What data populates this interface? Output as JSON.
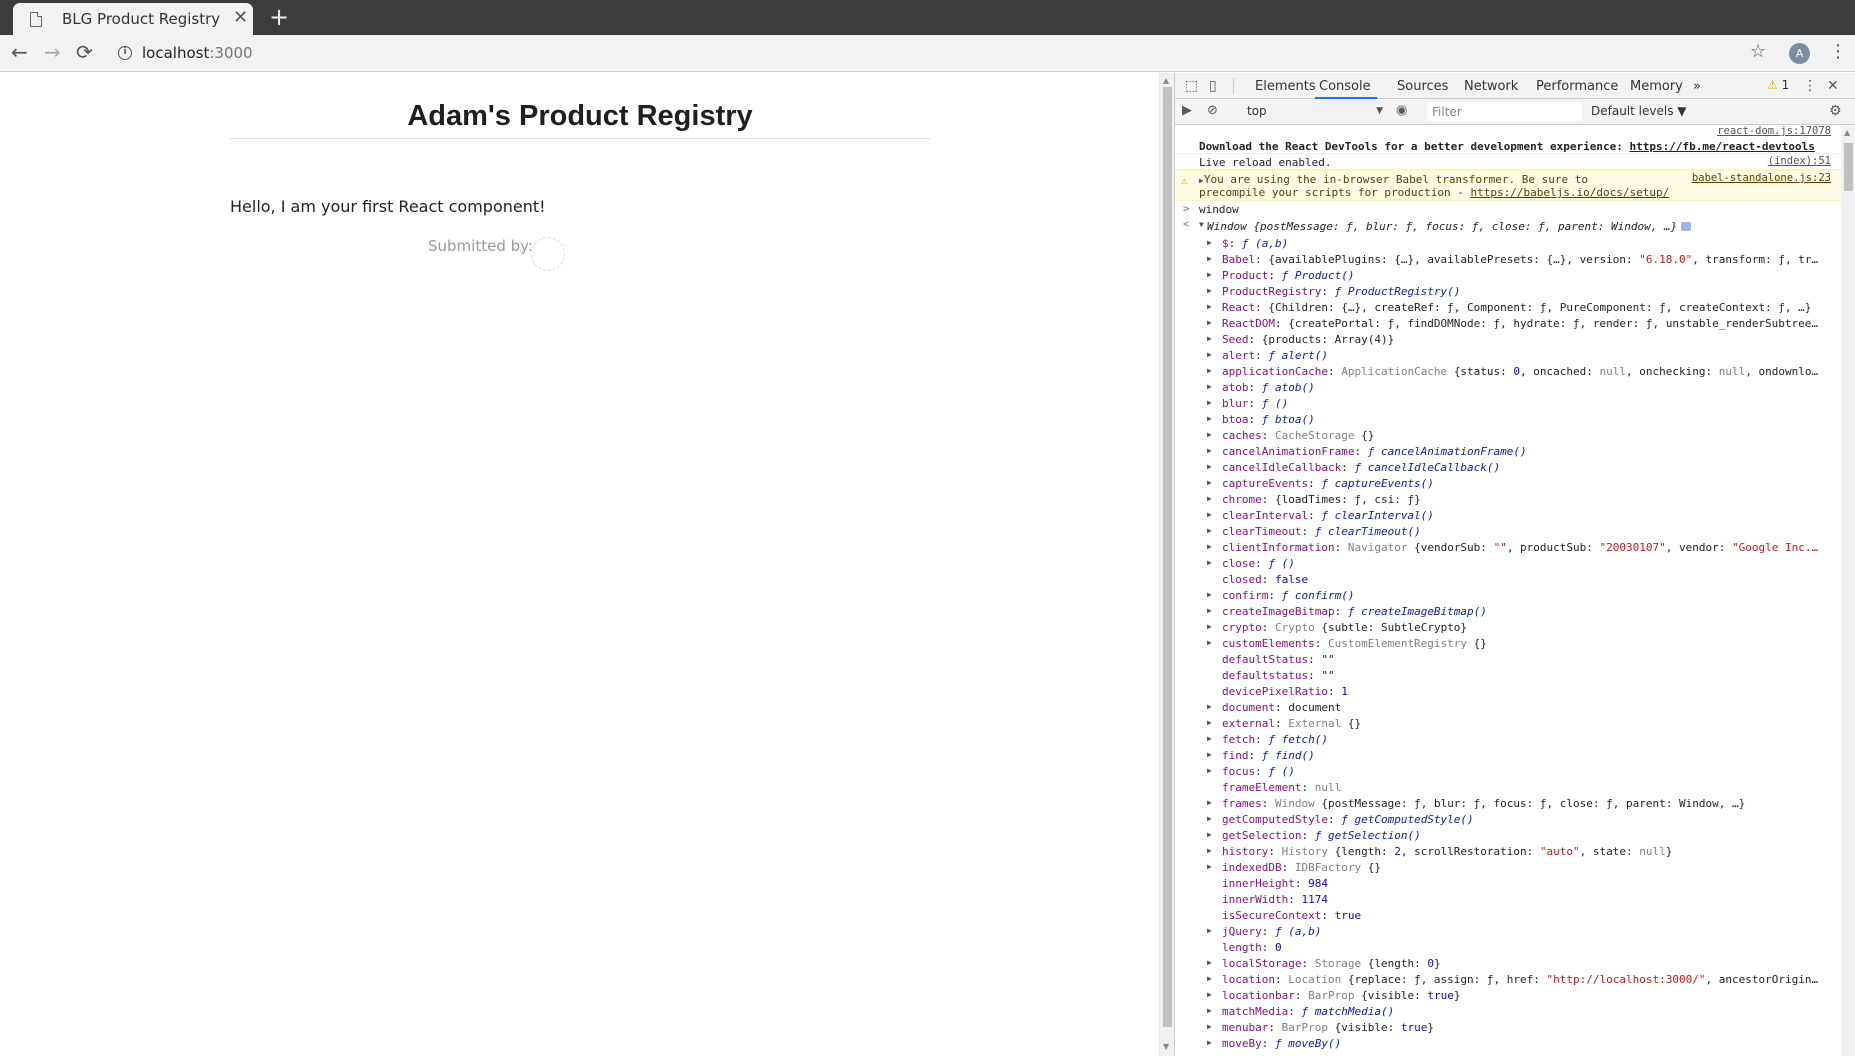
{
  "browser": {
    "tab_title": "BLG Product Registry",
    "tab_close": "✕",
    "new_tab": "+",
    "url_host": "localhost",
    "url_port": ":3000",
    "avatar_letter": "A"
  },
  "page": {
    "title": "Adam's Product Registry",
    "hello": "Hello, I am your first React component!",
    "submitted_by": "Submitted by:"
  },
  "devtools": {
    "tabs": [
      "Elements",
      "Console",
      "Sources",
      "Network",
      "Performance",
      "Memory"
    ],
    "active_tab": "Console",
    "more_tabs": "»",
    "warning_count": "1",
    "context": "top",
    "filter_placeholder": "Filter",
    "levels": "Default levels ▼",
    "messages": {
      "react_src": "react-dom.js:17078",
      "react_msg": "Download the React DevTools for a better development experience: ",
      "react_link": "https://fb.me/react-devtools",
      "live_src": "(index):51",
      "live_msg": "Live reload enabled.",
      "babel_src": "babel-standalone.js:23",
      "babel_line1": "You are using the in-browser Babel transformer. Be sure to",
      "babel_line2": "precompile your scripts for production - ",
      "babel_link": "https://babeljs.io/docs/setup/",
      "input": "window",
      "result": "Window {postMessage: ƒ, blur: ƒ, focus: ƒ, close: ƒ, parent: Window, …}"
    },
    "properties": [
      {
        "exp": true,
        "key": "$",
        "parts": [
          [
            "f",
            "ƒ (a,b)"
          ]
        ]
      },
      {
        "exp": true,
        "key": "Babel",
        "parts": [
          [
            "t",
            "{availablePlugins: {…}, availablePresets: {…}, version: "
          ],
          [
            "s",
            "\"6.18.0\""
          ],
          [
            "t",
            ", transform: ƒ, tr…"
          ]
        ]
      },
      {
        "exp": true,
        "key": "Product",
        "parts": [
          [
            "f",
            "ƒ Product()"
          ]
        ]
      },
      {
        "exp": true,
        "key": "ProductRegistry",
        "parts": [
          [
            "f",
            "ƒ ProductRegistry()"
          ]
        ]
      },
      {
        "exp": true,
        "key": "React",
        "parts": [
          [
            "t",
            "{Children: {…}, createRef: ƒ, Component: ƒ, PureComponent: ƒ, createContext: ƒ, …}"
          ]
        ]
      },
      {
        "exp": true,
        "key": "ReactDOM",
        "parts": [
          [
            "t",
            "{createPortal: ƒ, findDOMNode: ƒ, hydrate: ƒ, render: ƒ, unstable_renderSubtree…"
          ]
        ]
      },
      {
        "exp": true,
        "key": "Seed",
        "parts": [
          [
            "t",
            "{products: Array(4)}"
          ]
        ]
      },
      {
        "exp": true,
        "key": "alert",
        "parts": [
          [
            "f",
            "ƒ alert()"
          ]
        ]
      },
      {
        "exp": true,
        "key": "applicationCache",
        "parts": [
          [
            "c",
            "ApplicationCache "
          ],
          [
            "t",
            "{status: "
          ],
          [
            "n",
            "0"
          ],
          [
            "t",
            ", oncached: "
          ],
          [
            "c",
            "null"
          ],
          [
            "t",
            ", onchecking: "
          ],
          [
            "c",
            "null"
          ],
          [
            "t",
            ", ondownlo…"
          ]
        ]
      },
      {
        "exp": true,
        "key": "atob",
        "parts": [
          [
            "f",
            "ƒ atob()"
          ]
        ]
      },
      {
        "exp": true,
        "key": "blur",
        "parts": [
          [
            "f",
            "ƒ ()"
          ]
        ]
      },
      {
        "exp": true,
        "key": "btoa",
        "parts": [
          [
            "f",
            "ƒ btoa()"
          ]
        ]
      },
      {
        "exp": true,
        "key": "caches",
        "parts": [
          [
            "c",
            "CacheStorage "
          ],
          [
            "t",
            "{}"
          ]
        ]
      },
      {
        "exp": true,
        "key": "cancelAnimationFrame",
        "parts": [
          [
            "f",
            "ƒ cancelAnimationFrame()"
          ]
        ]
      },
      {
        "exp": true,
        "key": "cancelIdleCallback",
        "parts": [
          [
            "f",
            "ƒ cancelIdleCallback()"
          ]
        ]
      },
      {
        "exp": true,
        "key": "captureEvents",
        "parts": [
          [
            "f",
            "ƒ captureEvents()"
          ]
        ]
      },
      {
        "exp": true,
        "key": "chrome",
        "parts": [
          [
            "t",
            "{loadTimes: ƒ, csi: ƒ}"
          ]
        ]
      },
      {
        "exp": true,
        "key": "clearInterval",
        "parts": [
          [
            "f",
            "ƒ clearInterval()"
          ]
        ]
      },
      {
        "exp": true,
        "key": "clearTimeout",
        "parts": [
          [
            "f",
            "ƒ clearTimeout()"
          ]
        ]
      },
      {
        "exp": true,
        "key": "clientInformation",
        "parts": [
          [
            "c",
            "Navigator "
          ],
          [
            "t",
            "{vendorSub: "
          ],
          [
            "s",
            "\"\""
          ],
          [
            "t",
            ", productSub: "
          ],
          [
            "s",
            "\"20030107\""
          ],
          [
            "t",
            ", vendor: "
          ],
          [
            "s",
            "\"Google Inc.…"
          ]
        ]
      },
      {
        "exp": true,
        "key": "close",
        "parts": [
          [
            "f",
            "ƒ ()"
          ]
        ]
      },
      {
        "exp": false,
        "key": "closed",
        "parts": [
          [
            "n",
            "false"
          ]
        ]
      },
      {
        "exp": true,
        "key": "confirm",
        "parts": [
          [
            "f",
            "ƒ confirm()"
          ]
        ]
      },
      {
        "exp": true,
        "key": "createImageBitmap",
        "parts": [
          [
            "f",
            "ƒ createImageBitmap()"
          ]
        ]
      },
      {
        "exp": true,
        "key": "crypto",
        "parts": [
          [
            "c",
            "Crypto "
          ],
          [
            "t",
            "{subtle: SubtleCrypto}"
          ]
        ]
      },
      {
        "exp": true,
        "key": "customElements",
        "parts": [
          [
            "c",
            "CustomElementRegistry "
          ],
          [
            "t",
            "{}"
          ]
        ]
      },
      {
        "exp": false,
        "key": "defaultStatus",
        "parts": [
          [
            "t",
            "\"\""
          ]
        ]
      },
      {
        "exp": false,
        "key": "defaultstatus",
        "parts": [
          [
            "t",
            "\"\""
          ]
        ]
      },
      {
        "exp": false,
        "key": "devicePixelRatio",
        "parts": [
          [
            "n",
            "1"
          ]
        ]
      },
      {
        "exp": true,
        "key": "document",
        "parts": [
          [
            "k",
            "document"
          ]
        ]
      },
      {
        "exp": true,
        "key": "external",
        "parts": [
          [
            "c",
            "External "
          ],
          [
            "t",
            "{}"
          ]
        ]
      },
      {
        "exp": true,
        "key": "fetch",
        "parts": [
          [
            "f",
            "ƒ fetch()"
          ]
        ]
      },
      {
        "exp": true,
        "key": "find",
        "parts": [
          [
            "f",
            "ƒ find()"
          ]
        ]
      },
      {
        "exp": true,
        "key": "focus",
        "parts": [
          [
            "f",
            "ƒ ()"
          ]
        ]
      },
      {
        "exp": false,
        "key": "frameElement",
        "parts": [
          [
            "c",
            "null"
          ]
        ]
      },
      {
        "exp": true,
        "key": "frames",
        "parts": [
          [
            "c",
            "Window "
          ],
          [
            "t",
            "{postMessage: ƒ, blur: ƒ, focus: ƒ, close: ƒ, parent: Window, …}"
          ]
        ]
      },
      {
        "exp": true,
        "key": "getComputedStyle",
        "parts": [
          [
            "f",
            "ƒ getComputedStyle()"
          ]
        ]
      },
      {
        "exp": true,
        "key": "getSelection",
        "parts": [
          [
            "f",
            "ƒ getSelection()"
          ]
        ]
      },
      {
        "exp": true,
        "key": "history",
        "parts": [
          [
            "c",
            "History "
          ],
          [
            "t",
            "{length: "
          ],
          [
            "n",
            "2"
          ],
          [
            "t",
            ", scrollRestoration: "
          ],
          [
            "s",
            "\"auto\""
          ],
          [
            "t",
            ", state: "
          ],
          [
            "c",
            "null"
          ],
          [
            "t",
            "}"
          ]
        ]
      },
      {
        "exp": true,
        "key": "indexedDB",
        "parts": [
          [
            "c",
            "IDBFactory "
          ],
          [
            "t",
            "{}"
          ]
        ]
      },
      {
        "exp": false,
        "key": "innerHeight",
        "parts": [
          [
            "n",
            "984"
          ]
        ]
      },
      {
        "exp": false,
        "key": "innerWidth",
        "parts": [
          [
            "n",
            "1174"
          ]
        ]
      },
      {
        "exp": false,
        "key": "isSecureContext",
        "parts": [
          [
            "n",
            "true"
          ]
        ]
      },
      {
        "exp": true,
        "key": "jQuery",
        "parts": [
          [
            "f",
            "ƒ (a,b)"
          ]
        ]
      },
      {
        "exp": false,
        "key": "length",
        "parts": [
          [
            "n",
            "0"
          ]
        ]
      },
      {
        "exp": true,
        "key": "localStorage",
        "parts": [
          [
            "c",
            "Storage "
          ],
          [
            "t",
            "{length: "
          ],
          [
            "n",
            "0"
          ],
          [
            "t",
            "}"
          ]
        ]
      },
      {
        "exp": true,
        "key": "location",
        "parts": [
          [
            "c",
            "Location "
          ],
          [
            "t",
            "{replace: ƒ, assign: ƒ, href: "
          ],
          [
            "s",
            "\"http://localhost:3000/\""
          ],
          [
            "t",
            ", ancestorOrigin…"
          ]
        ]
      },
      {
        "exp": true,
        "key": "locationbar",
        "parts": [
          [
            "c",
            "BarProp "
          ],
          [
            "t",
            "{visible: "
          ],
          [
            "n",
            "true"
          ],
          [
            "t",
            "}"
          ]
        ]
      },
      {
        "exp": true,
        "key": "matchMedia",
        "parts": [
          [
            "f",
            "ƒ matchMedia()"
          ]
        ]
      },
      {
        "exp": true,
        "key": "menubar",
        "parts": [
          [
            "c",
            "BarProp "
          ],
          [
            "t",
            "{visible: "
          ],
          [
            "n",
            "true"
          ],
          [
            "t",
            "}"
          ]
        ]
      },
      {
        "exp": true,
        "key": "moveBy",
        "parts": [
          [
            "f",
            "ƒ moveBy()"
          ]
        ]
      }
    ]
  }
}
